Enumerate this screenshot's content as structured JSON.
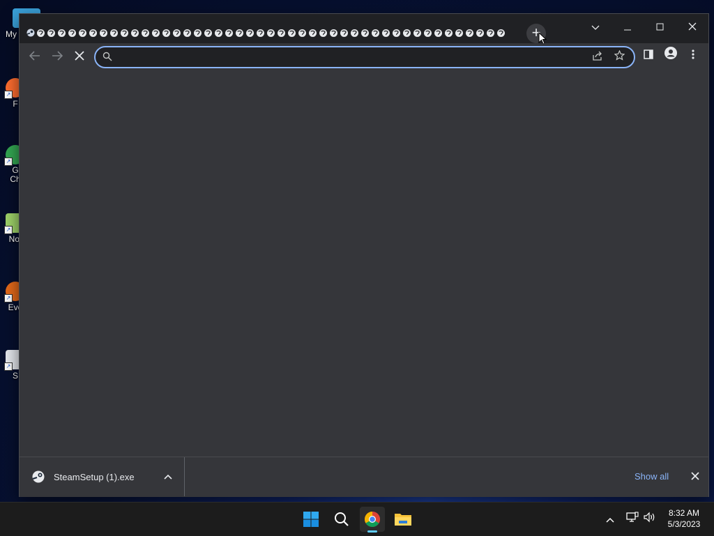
{
  "desktop": {
    "icons": [
      {
        "label": "My C",
        "icon": "this-pc-icon",
        "color": "#3aa0d8"
      },
      {
        "label": "F",
        "icon": "firefox-icon",
        "color": "#ff6d2f"
      },
      {
        "label": "G\nCh",
        "icon": "chrome-icon",
        "color": "#34a853"
      },
      {
        "label": "Not",
        "icon": "notepad-icon",
        "color": "#9fd36a"
      },
      {
        "label": "Eve",
        "icon": "everything-icon",
        "color": "#e56a1a"
      },
      {
        "label": "S",
        "icon": "steam-setup-icon",
        "color": "#ffffff"
      }
    ]
  },
  "browser": {
    "tab_count": 45,
    "new_tab_label": "+",
    "address_bar": {
      "value": "",
      "placeholder": ""
    },
    "download_bar": {
      "filename": "SteamSetup (1).exe",
      "show_all_label": "Show all"
    }
  },
  "taskbar": {
    "time": "8:32 AM",
    "date": "5/3/2023"
  },
  "colors": {
    "frame": "#202124",
    "toolbar": "#35363a",
    "accent": "#8ab4f8",
    "taskbar": "#1c1c1c"
  }
}
